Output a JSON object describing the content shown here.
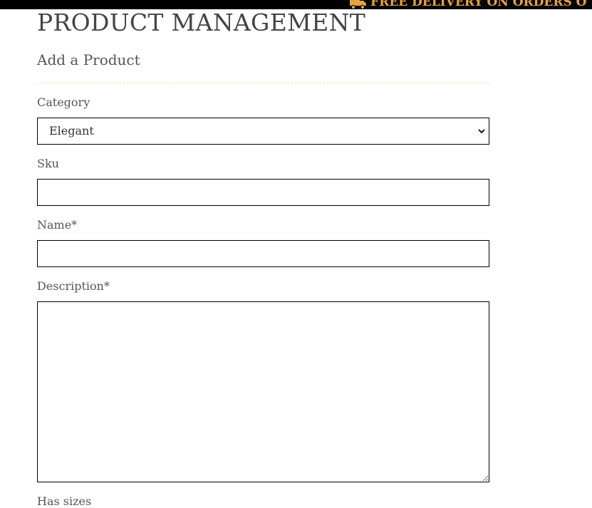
{
  "banner": {
    "text": "FREE DELIVERY ON ORDERS O",
    "icon": "truck-icon",
    "background_color": "#000000",
    "text_color": "#e8a33a"
  },
  "page": {
    "title": "PRODUCT MANAGEMENT",
    "section_title": "Add a Product"
  },
  "form": {
    "category": {
      "label": "Category",
      "selected": "Elegant"
    },
    "sku": {
      "label": "Sku",
      "value": ""
    },
    "name": {
      "label": "Name*",
      "value": ""
    },
    "description": {
      "label": "Description*",
      "value": ""
    },
    "has_sizes": {
      "label": "Has sizes"
    }
  }
}
